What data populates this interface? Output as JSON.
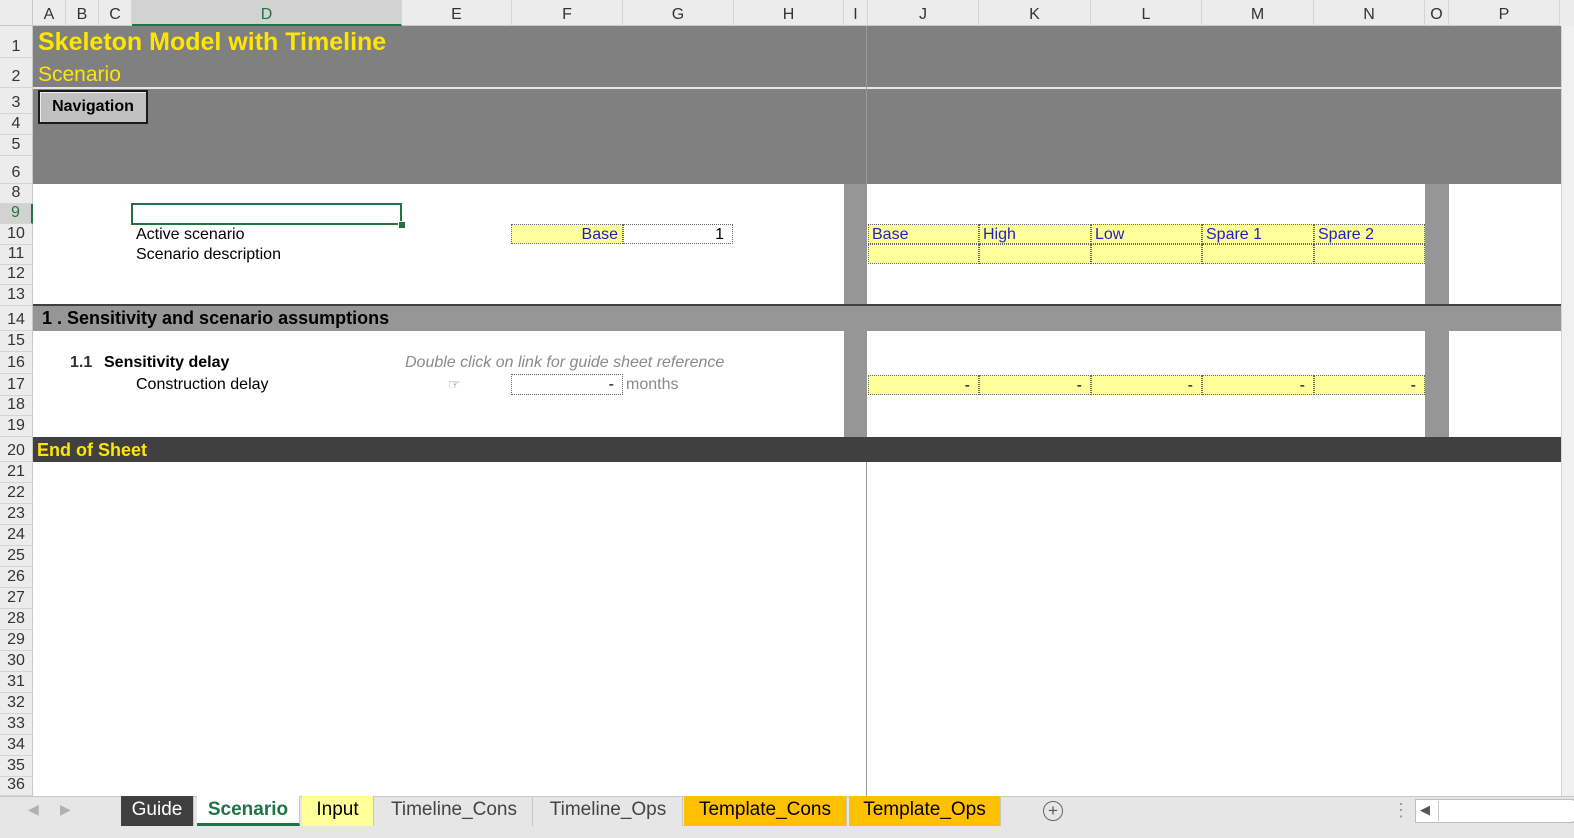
{
  "columns": [
    "A",
    "B",
    "C",
    "D",
    "E",
    "F",
    "G",
    "H",
    "I",
    "J",
    "K",
    "L",
    "M",
    "N",
    "O",
    "P"
  ],
  "rows": [
    "1",
    "2",
    "3",
    "4",
    "5",
    "6",
    "8",
    "9",
    "10",
    "11",
    "12",
    "13",
    "14",
    "15",
    "16",
    "17",
    "18",
    "19",
    "20",
    "21",
    "22",
    "23",
    "24",
    "25",
    "26",
    "27",
    "28",
    "29",
    "30",
    "31",
    "32",
    "33",
    "34",
    "35",
    "36"
  ],
  "header": {
    "title": "Skeleton Model with Timeline",
    "subtitle": "Scenario",
    "navigation_button": "Navigation"
  },
  "scenario": {
    "active_label": "Active scenario",
    "active_value": "Base",
    "active_index": "1",
    "description_label": "Scenario description",
    "options": [
      "Base",
      "High",
      "Low",
      "Spare 1",
      "Spare 2"
    ]
  },
  "section1": {
    "title": "1 . Sensitivity and scenario assumptions",
    "sub_number": "1.1",
    "sub_title": "Sensitivity delay",
    "guide_note": "Double click on link for guide sheet reference",
    "link_icon": "☞",
    "construction_label": "Construction delay",
    "construction_value": "-",
    "construction_unit": "months",
    "timeline_values": [
      "-",
      "-",
      "-",
      "-",
      "-"
    ]
  },
  "end_of_sheet": "End of Sheet",
  "tabs": [
    {
      "label": "Guide",
      "style": "dark"
    },
    {
      "label": "Scenario",
      "style": "active"
    },
    {
      "label": "Input",
      "style": "yellow"
    },
    {
      "label": "Timeline_Cons",
      "style": "normal"
    },
    {
      "label": "Timeline_Ops",
      "style": "normal"
    },
    {
      "label": "Template_Cons",
      "style": "orange"
    },
    {
      "label": "Template_Ops",
      "style": "orange"
    }
  ],
  "colors": {
    "title_yellow": "#ffe600",
    "header_gray": "#808080",
    "section_gray": "#969696",
    "end_dark": "#404040",
    "input_yellow": "#ffff99",
    "excel_green": "#217346",
    "tab_orange": "#ffc000"
  }
}
